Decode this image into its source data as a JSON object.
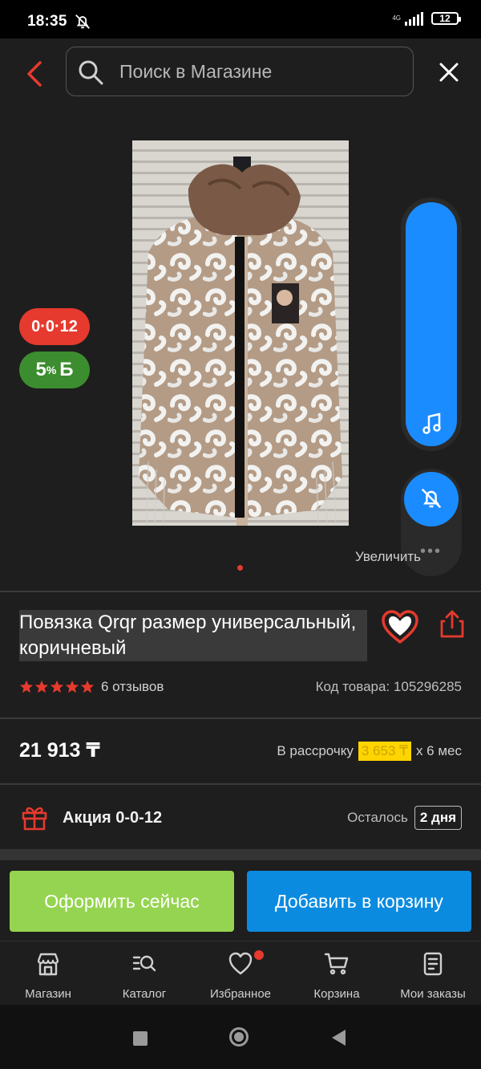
{
  "status": {
    "time": "18:35",
    "network": "4G",
    "battery": "12"
  },
  "search": {
    "placeholder": "Поиск в Магазине"
  },
  "badges": {
    "promo": "0·0·12",
    "bonus_value": "5",
    "bonus_unit": "%",
    "bonus_symbol": "Б"
  },
  "gallery": {
    "zoom_hint": "Увеличить",
    "current_index": 1
  },
  "product": {
    "title": "Повязка Qrqr размер универсальный, коричневый",
    "rating": 5,
    "reviews": "6 отзывов",
    "sku": "Код товара: 105296285",
    "price": "21 913 ₸",
    "installment_prefix": "В рассрочку",
    "installment_amount": "3 653 ₸",
    "installment_suffix": "x 6 мес"
  },
  "promotion": {
    "label": "Акция 0-0-12",
    "remaining_label": "Осталось",
    "remaining_days": "2 дня"
  },
  "actions": {
    "buy_now": "Оформить сейчас",
    "add_to_cart": "Добавить в корзину"
  },
  "tabs": [
    {
      "label": "Магазин",
      "icon": "store-icon"
    },
    {
      "label": "Каталог",
      "icon": "catalog-search-icon"
    },
    {
      "label": "Избранное",
      "icon": "heart-icon"
    },
    {
      "label": "Корзина",
      "icon": "cart-icon"
    },
    {
      "label": "Мои заказы",
      "icon": "orders-icon"
    }
  ],
  "colors": {
    "accent_red": "#e63a2e",
    "buy_green": "#95d450",
    "cart_blue": "#0b8be0",
    "bonus_green": "#3c8d2f",
    "float_blue": "#1a8cff"
  }
}
